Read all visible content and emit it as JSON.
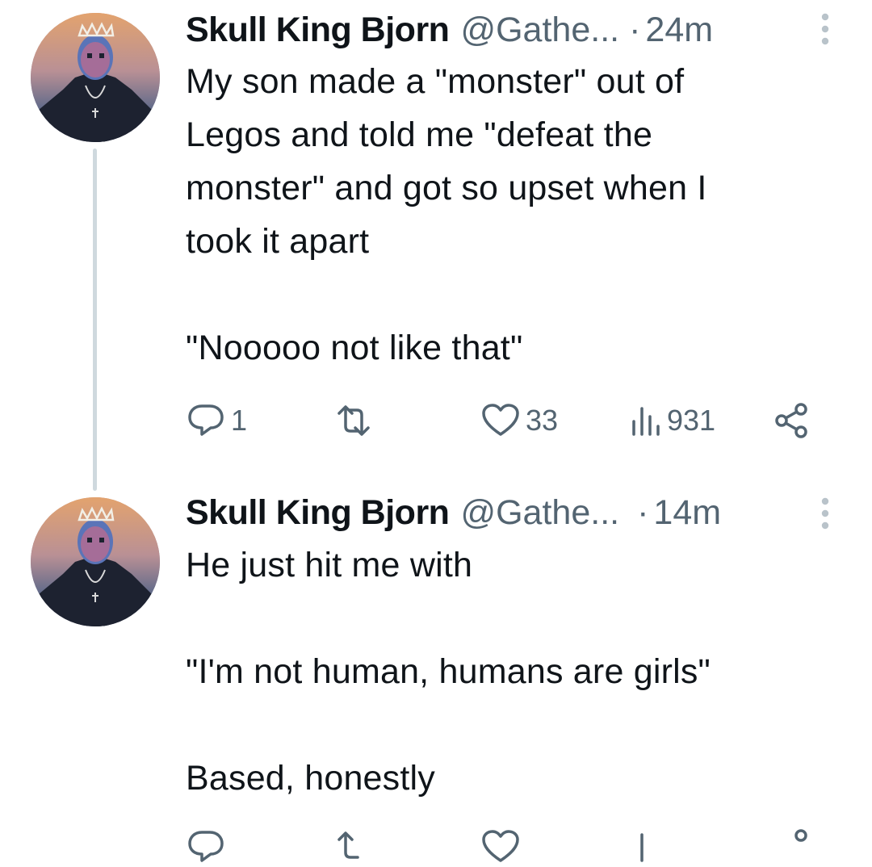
{
  "tweets": [
    {
      "display_name": "Skull King Bjorn",
      "handle": "@Gathe...",
      "separator": "·",
      "time": "24m",
      "text": "My son made a \"monster\" out of\nLegos and told me \"defeat the\nmonster\" and got so upset when I\ntook it apart\n\n\"Nooooo not like that\"",
      "reply_count": "1",
      "retweet_count": "",
      "like_count": "33",
      "view_count": "931"
    },
    {
      "display_name": "Skull King Bjorn",
      "handle": "@Gathe...",
      "separator": "·",
      "time": "14m",
      "text": "He just hit me with\n\n\"I'm not human, humans are girls\"\n\nBased, honestly"
    }
  ],
  "icons": {
    "reply": "reply-icon",
    "retweet": "retweet-icon",
    "like": "heart-icon",
    "views": "views-icon",
    "share": "share-icon",
    "more": "more-vertical-icon"
  },
  "colors": {
    "text_primary": "#0f1419",
    "text_secondary": "#536471",
    "thread_line": "#cfd9de"
  }
}
